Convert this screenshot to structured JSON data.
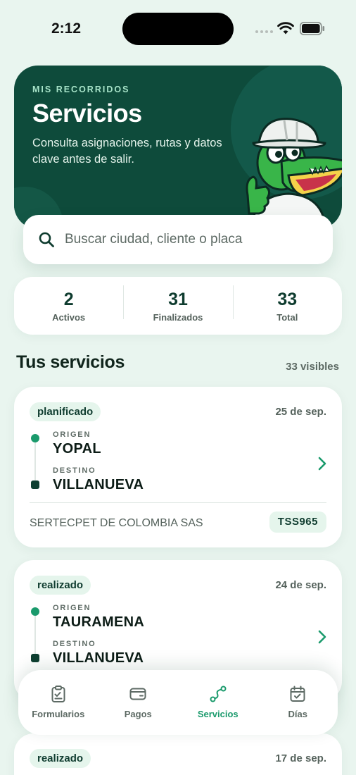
{
  "status_bar": {
    "time": "2:12"
  },
  "hero": {
    "kicker": "MIS RECORRIDOS",
    "title": "Servicios",
    "description": "Consulta asignaciones, rutas y datos clave antes de salir."
  },
  "search": {
    "placeholder": "Buscar ciudad, cliente o placa",
    "value": ""
  },
  "stats": [
    {
      "value": "2",
      "label": "Activos"
    },
    {
      "value": "31",
      "label": "Finalizados"
    },
    {
      "value": "33",
      "label": "Total"
    }
  ],
  "section": {
    "title": "Tus servicios",
    "count": "33 visibles"
  },
  "services": [
    {
      "status": "planificado",
      "date": "25 de sep.",
      "origin_label": "ORIGEN",
      "origin": "YOPAL",
      "destination_label": "DESTINO",
      "destination": "VILLANUEVA",
      "client": "SERTECPET DE COLOMBIA SAS",
      "plate": "TSS965"
    },
    {
      "status": "realizado",
      "date": "24 de sep.",
      "origin_label": "ORIGEN",
      "origin": "TAURAMENA",
      "destination_label": "DESTINO",
      "destination": "VILLANUEVA"
    },
    {
      "status": "realizado",
      "date": "17 de sep."
    }
  ],
  "tabs": [
    {
      "label": "Formularios",
      "icon": "clipboard-icon",
      "active": false
    },
    {
      "label": "Pagos",
      "icon": "wallet-icon",
      "active": false
    },
    {
      "label": "Servicios",
      "icon": "route-icon",
      "active": true
    },
    {
      "label": "Días",
      "icon": "calendar-icon",
      "active": false
    }
  ],
  "colors": {
    "background": "#e9f5ef",
    "hero": "#0e4b3b",
    "accent": "#1a9a6c",
    "dark_green": "#0f3c2f",
    "badge_bg": "#e5f5ec"
  }
}
